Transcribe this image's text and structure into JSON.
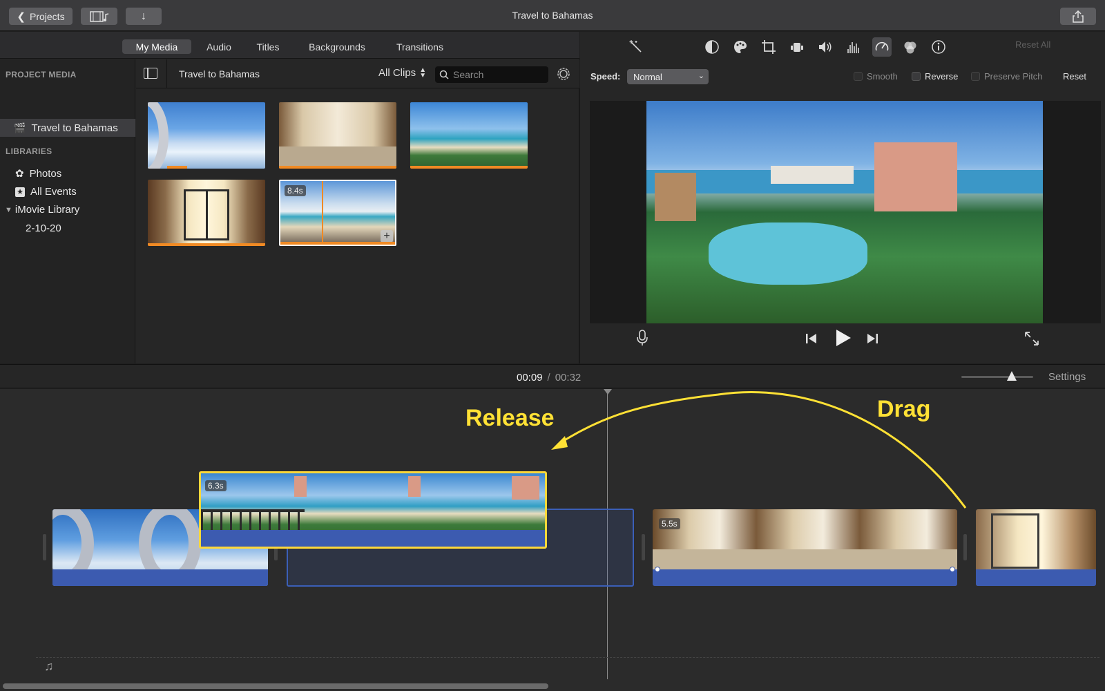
{
  "window": {
    "title": "Travel to Bahamas"
  },
  "toolbar": {
    "projects_label": "Projects"
  },
  "browser": {
    "tabs": [
      {
        "label": "My Media",
        "active": true
      },
      {
        "label": "Audio"
      },
      {
        "label": "Titles"
      },
      {
        "label": "Backgrounds"
      },
      {
        "label": "Transitions"
      }
    ],
    "sidebar": {
      "project_media_heading": "PROJECT MEDIA",
      "project_item": "Travel to Bahamas",
      "libraries_heading": "LIBRARIES",
      "photos": "Photos",
      "all_events": "All Events",
      "library": "iMovie Library",
      "event": "2-10-20"
    },
    "media_bar": {
      "title": "Travel to Bahamas",
      "filter": "All Clips",
      "search_placeholder": "Search"
    },
    "thumbnails": [
      {
        "scene": "airplane-window",
        "bar_fraction": 0.5
      },
      {
        "scene": "hotel-lobby",
        "bar_fraction": 1.0
      },
      {
        "scene": "beach-aerial",
        "bar_fraction": 1.0
      },
      {
        "scene": "glass-doors",
        "bar_fraction": 1.0
      },
      {
        "scene": "beach-chairs",
        "bar_fraction": 1.0,
        "duration": "8.4s",
        "selected": true
      }
    ]
  },
  "viewer": {
    "reset_all": "Reset All",
    "speed_label": "Speed:",
    "speed_value": "Normal",
    "smooth": "Smooth",
    "reverse": "Reverse",
    "preserve_pitch": "Preserve Pitch",
    "reset": "Reset"
  },
  "timeline": {
    "current_time": "00:09",
    "separator": "/",
    "total_time": "00:32",
    "settings_label": "Settings",
    "zoom_fraction": 0.7,
    "dragged_clip_duration": "6.3s",
    "clip3_duration": "5.5s",
    "annotations": {
      "release": "Release",
      "drag": "Drag"
    }
  },
  "colors": {
    "accent_orange": "#f08a24",
    "selection_yellow": "#ffd83a",
    "audio_blue": "#3c5bb0",
    "annotation_yellow": "#ffe135"
  }
}
